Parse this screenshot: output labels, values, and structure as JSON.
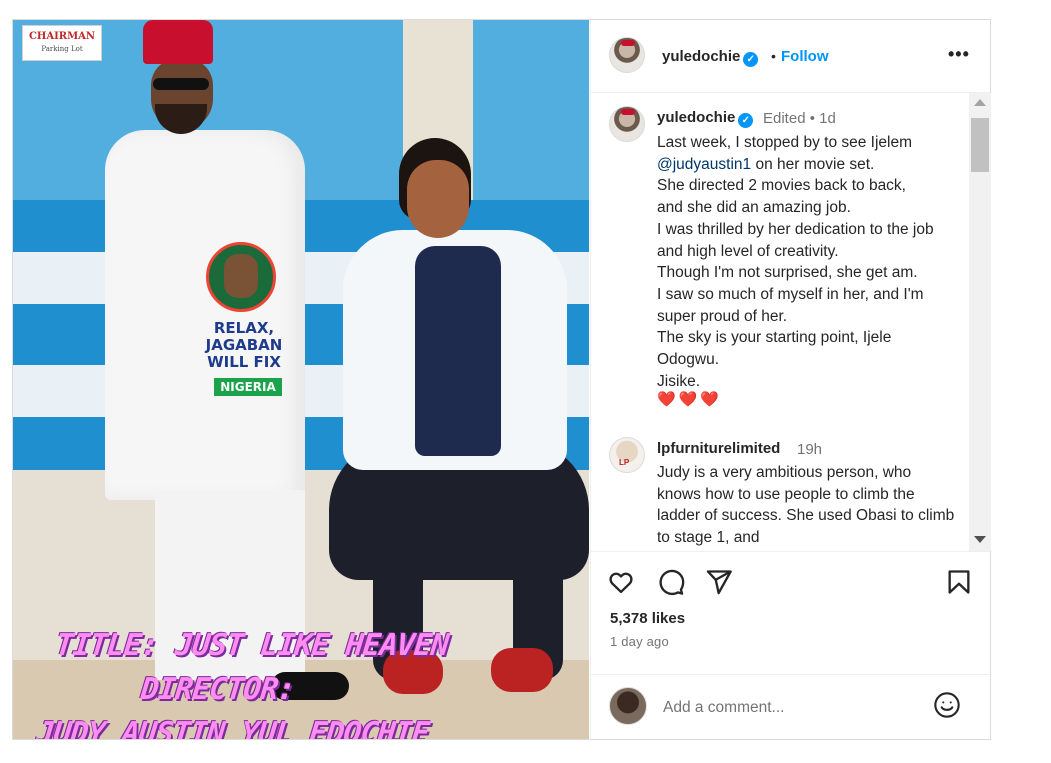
{
  "photo": {
    "sign_line1": "CHAIRMAN",
    "sign_line2": "Parking Lot",
    "shirt_text": "RELAX, JAGABAN WILL FIX",
    "shirt_banner": "NIGERIA",
    "overlay_line1": "TITLE: JUST LIKE HEAVEN",
    "overlay_line2": "DIRECTOR:",
    "overlay_line3": "JUDY AUSTIN YUL EDOCHIE"
  },
  "header": {
    "username": "yuledochie",
    "verified_mark": "✓",
    "separator": "•",
    "follow_label": "Follow",
    "more_icon": "•••"
  },
  "caption": {
    "username": "yuledochie",
    "meta": "Edited • 1d",
    "text_before_mention": "Last week, I stopped by to see Ijelem",
    "mention": "@judyaustin1",
    "text_after_mention": " on her movie set.",
    "lines": [
      "She directed 2 movies back to back,",
      "and she did an amazing job.",
      "I was thrilled by her dedication to the job and high level of creativity.",
      "Though I'm not surprised, she get am.",
      "I saw so much of myself in her, and I'm super proud of her.",
      "The sky is your starting point, Ijele Odogwu.",
      "Jisike."
    ],
    "hearts": "❤️❤️❤️"
  },
  "comment": {
    "username": "lpfurniturelimited",
    "time": "19h",
    "text": "Judy is a very ambitious person, who knows how to use people to climb the ladder of success. She used Obasi to climb to stage 1, and"
  },
  "actions": {
    "likes": "5,378 likes",
    "time_ago": "1 day ago",
    "comment_placeholder": "Add a comment..."
  },
  "icons": {
    "like": "heart-icon",
    "comment": "comment-bubble-icon",
    "share": "paper-plane-icon",
    "save": "bookmark-icon",
    "emoji": "smiley-icon",
    "more": "more-horizontal-icon"
  },
  "colors": {
    "accent": "#0095f6",
    "text": "#262626",
    "muted": "#737373",
    "mention": "#00376b",
    "border": "#dbdbdb"
  }
}
